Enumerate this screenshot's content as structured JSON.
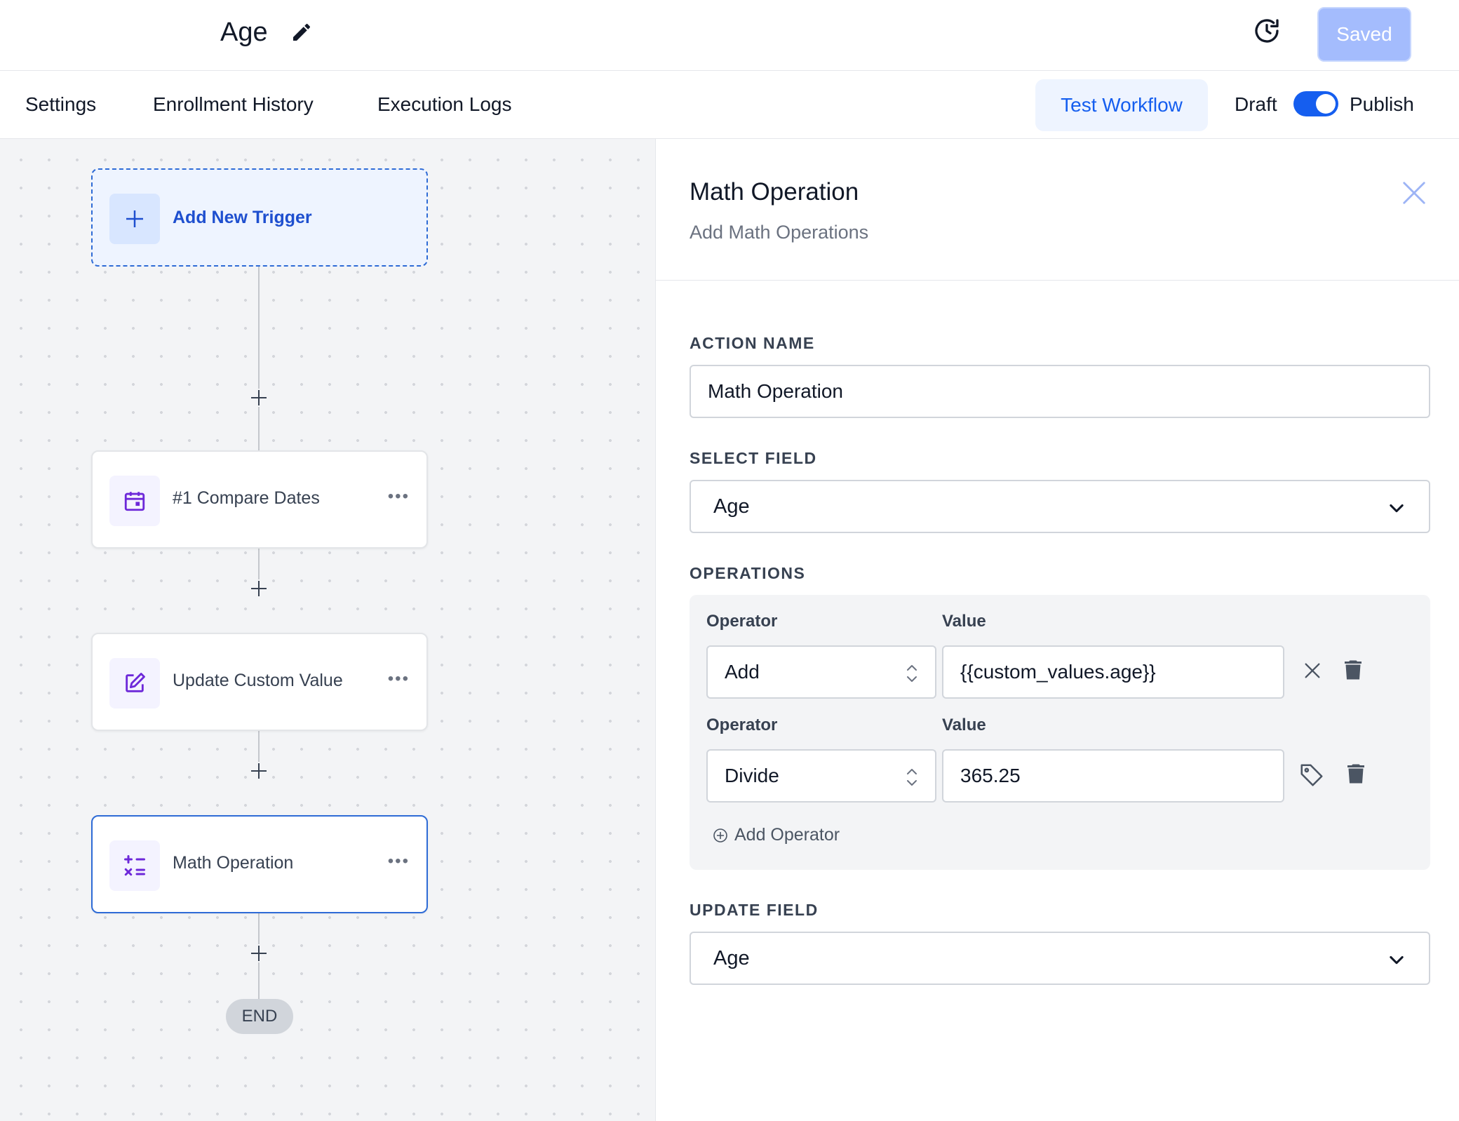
{
  "header": {
    "workflow_title": "Age",
    "saved_label": "Saved"
  },
  "tabs": [
    {
      "label": "Settings"
    },
    {
      "label": "Enrollment History"
    },
    {
      "label": "Execution Logs"
    }
  ],
  "toolbar": {
    "test_label": "Test Workflow",
    "draft_label": "Draft",
    "publish_label": "Publish",
    "publish_toggle_on": true
  },
  "canvas": {
    "trigger_label": "Add New Trigger",
    "nodes": [
      {
        "label": "#1 Compare Dates",
        "icon": "calendar-icon",
        "more": "•••"
      },
      {
        "label": "Update Custom Value",
        "icon": "edit-square-icon",
        "more": "•••"
      },
      {
        "label": "Math Operation",
        "icon": "math-icon",
        "more": "•••"
      }
    ],
    "end_label": "END"
  },
  "panel": {
    "title": "Math Operation",
    "subtitle": "Add Math Operations",
    "action_name_label": "ACTION NAME",
    "action_name_value": "Math Operation",
    "select_field_label": "SELECT FIELD",
    "select_field_value": "Age",
    "operations_label": "OPERATIONS",
    "operations": [
      {
        "operator_label": "Operator",
        "value_label": "Value",
        "operator": "Add",
        "value": "{{custom_values.age}}"
      },
      {
        "operator_label": "Operator",
        "value_label": "Value",
        "operator": "Divide",
        "value": "365.25"
      }
    ],
    "add_operator_label": "Add Operator",
    "update_field_label": "UPDATE FIELD",
    "update_field_value": "Age"
  },
  "colors": {
    "accent": "#155eef",
    "node_icon": "#6d28d9",
    "saved_button": "#a4bcfd"
  }
}
